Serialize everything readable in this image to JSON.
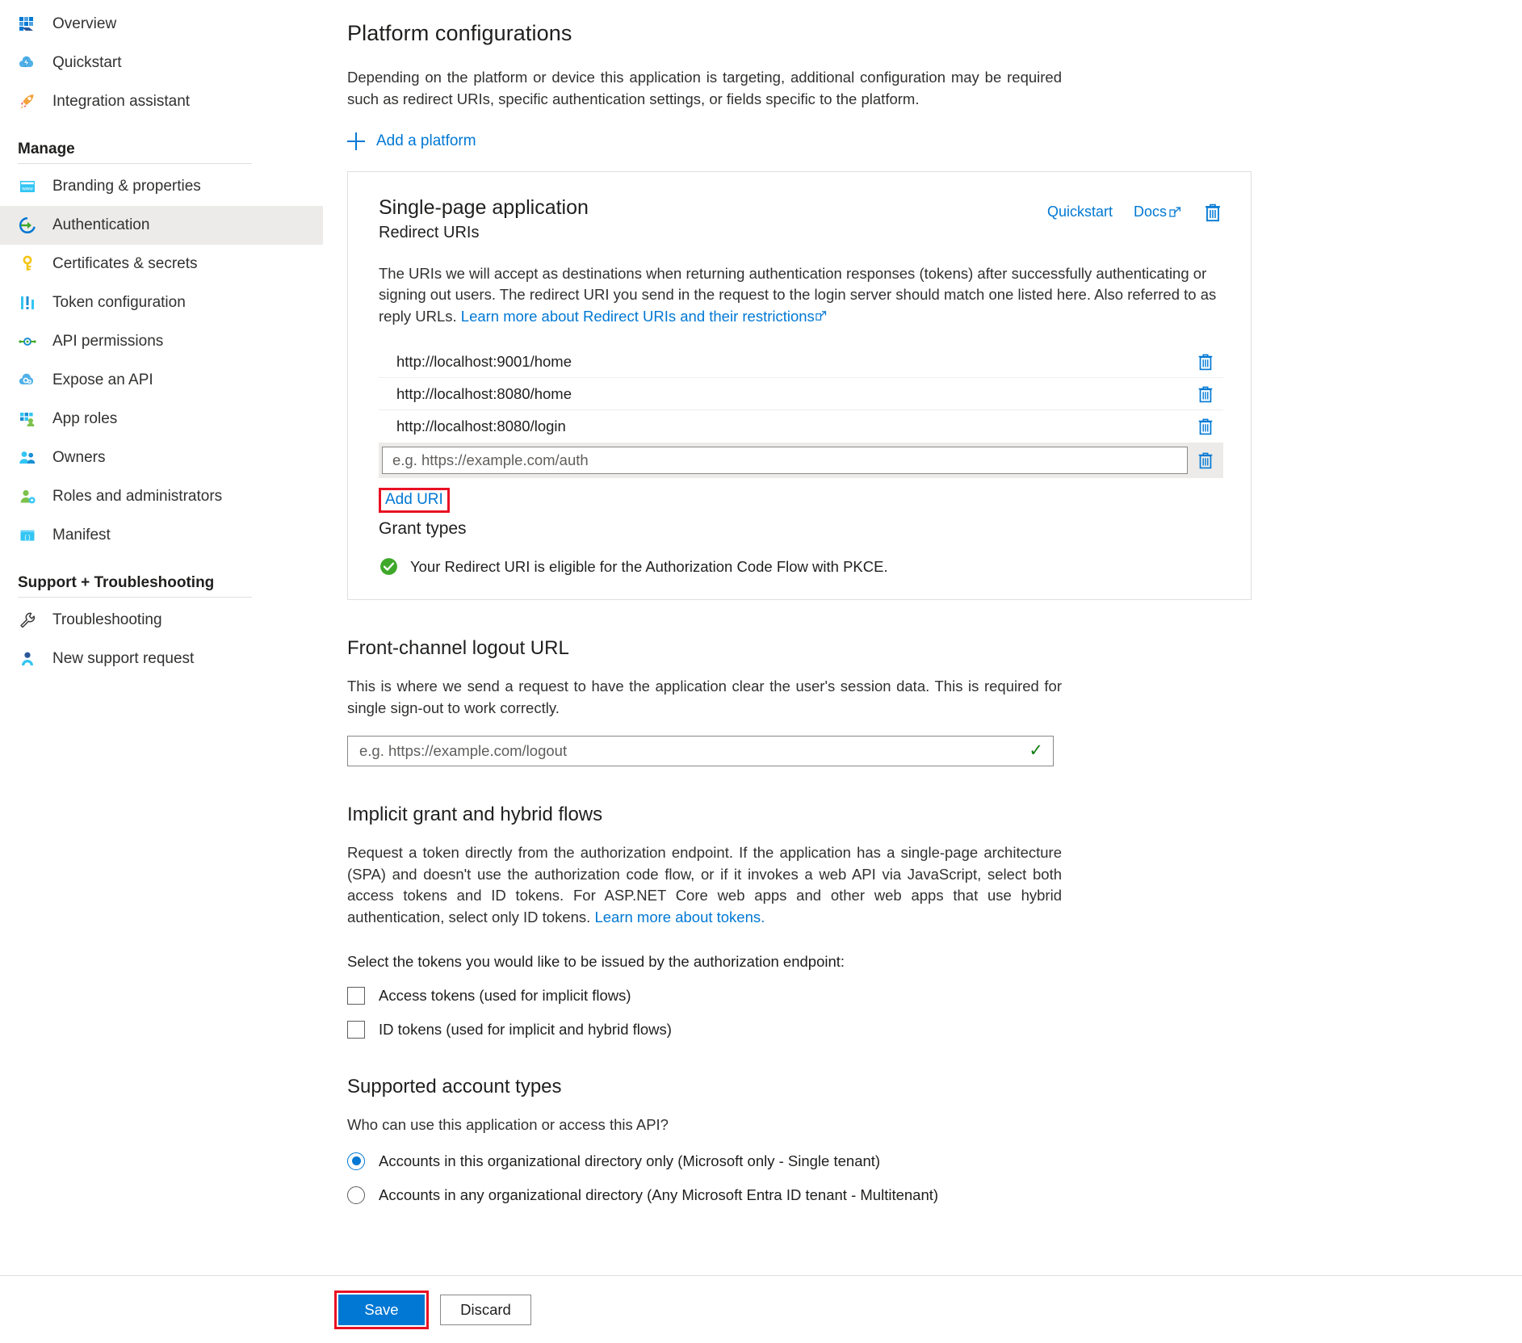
{
  "sidebar": {
    "top_items": [
      {
        "label": "Overview",
        "icon": "overview-icon"
      },
      {
        "label": "Quickstart",
        "icon": "quickstart-cloud-icon"
      },
      {
        "label": "Integration assistant",
        "icon": "rocket-icon"
      }
    ],
    "manage_header": "Manage",
    "manage_items": [
      {
        "label": "Branding & properties",
        "icon": "branding-window-icon",
        "selected": false
      },
      {
        "label": "Authentication",
        "icon": "authentication-arrow-icon",
        "selected": true
      },
      {
        "label": "Certificates & secrets",
        "icon": "key-icon",
        "selected": false
      },
      {
        "label": "Token configuration",
        "icon": "token-bars-icon",
        "selected": false
      },
      {
        "label": "API permissions",
        "icon": "api-permissions-icon",
        "selected": false
      },
      {
        "label": "Expose an API",
        "icon": "expose-api-cloud-icon",
        "selected": false
      },
      {
        "label": "App roles",
        "icon": "app-roles-icon",
        "selected": false
      },
      {
        "label": "Owners",
        "icon": "owners-people-icon",
        "selected": false
      },
      {
        "label": "Roles and administrators",
        "icon": "roles-admin-icon",
        "selected": false
      },
      {
        "label": "Manifest",
        "icon": "manifest-braces-icon",
        "selected": false
      }
    ],
    "support_header": "Support + Troubleshooting",
    "support_items": [
      {
        "label": "Troubleshooting",
        "icon": "wrench-icon"
      },
      {
        "label": "New support request",
        "icon": "support-person-icon"
      }
    ]
  },
  "main": {
    "title": "Platform configurations",
    "description": "Depending on the platform or device this application is targeting, additional configuration may be required such as redirect URIs, specific authentication settings, or fields specific to the platform.",
    "add_platform_label": "Add a platform",
    "platform_card": {
      "title": "Single-page application",
      "subtitle": "Redirect URIs",
      "quickstart_label": "Quickstart",
      "docs_label": "Docs",
      "description_part1": "The URIs we will accept as destinations when returning authentication responses (tokens) after successfully authenticating or signing out users. The redirect URI you send in the request to the login server should match one listed here. Also referred to as reply URLs. ",
      "description_link": "Learn more about Redirect URIs and their restrictions",
      "redirect_uris": [
        "http://localhost:9001/home",
        "http://localhost:8080/home",
        "http://localhost:8080/login"
      ],
      "new_uri_placeholder": "e.g. https://example.com/auth",
      "new_uri_value": "",
      "add_uri_label": "Add URI",
      "grant_types_title": "Grant types",
      "grant_status_text": "Your Redirect URI is eligible for the Authorization Code Flow with PKCE."
    },
    "front_channel": {
      "title": "Front-channel logout URL",
      "description": "This is where we send a request to have the application clear the user's session data. This is required for single sign-out to work correctly.",
      "placeholder": "e.g. https://example.com/logout",
      "value": ""
    },
    "implicit": {
      "title": "Implicit grant and hybrid flows",
      "description_part1": "Request a token directly from the authorization endpoint. If the application has a single-page architecture (SPA) and doesn't use the authorization code flow, or if it invokes a web API via JavaScript, select both access tokens and ID tokens. For ASP.NET Core web apps and other web apps that use hybrid authentication, select only ID tokens. ",
      "description_link": "Learn more about tokens.",
      "select_prompt": "Select the tokens you would like to be issued by the authorization endpoint:",
      "checkboxes": [
        {
          "label": "Access tokens (used for implicit flows)",
          "checked": false
        },
        {
          "label": "ID tokens (used for implicit and hybrid flows)",
          "checked": false
        }
      ]
    },
    "account_types": {
      "title": "Supported account types",
      "question": "Who can use this application or access this API?",
      "options": [
        {
          "label": "Accounts in this organizational directory only (Microsoft only - Single tenant)",
          "selected": true
        },
        {
          "label": "Accounts in any organizational directory (Any Microsoft Entra ID tenant - Multitenant)",
          "selected": false
        }
      ]
    }
  },
  "commandbar": {
    "save_label": "Save",
    "discard_label": "Discard"
  },
  "colors": {
    "accent_blue": "#0078d4",
    "link_blue": "#0078d4",
    "highlight_red": "#e81123",
    "success_green": "#107c10",
    "selected_bg": "#edebe9"
  }
}
